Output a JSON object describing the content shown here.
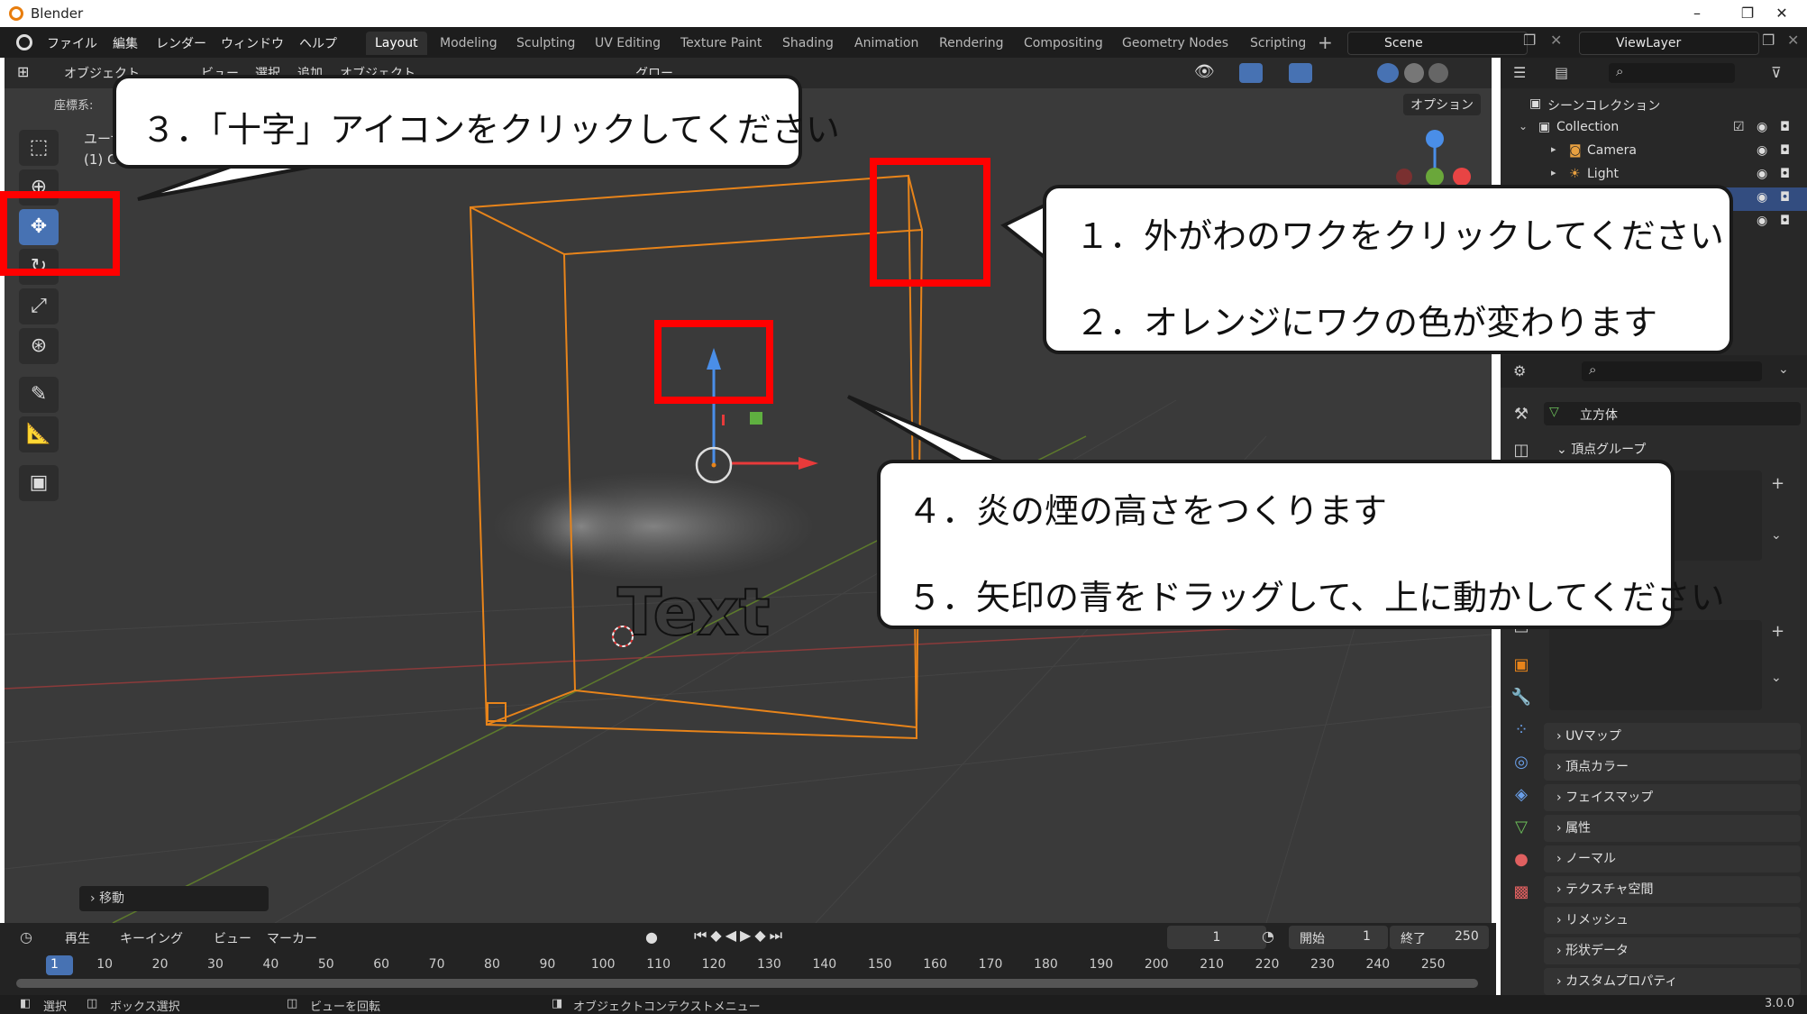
{
  "window": {
    "title": "Blender",
    "controls": [
      "–",
      "❐",
      "✕"
    ]
  },
  "menu": [
    "ファイル",
    "編集",
    "レンダー",
    "ウィンドウ",
    "ヘルプ"
  ],
  "workspaces": [
    "Layout",
    "Modeling",
    "Sculpting",
    "UV Editing",
    "Texture Paint",
    "Shading",
    "Animation",
    "Rendering",
    "Compositing",
    "Geometry Nodes",
    "Scripting"
  ],
  "active_workspace": "Layout",
  "scene": "Scene",
  "view_layer": "ViewLayer",
  "viewport": {
    "mode": "オブジェクト",
    "header_items": [
      "ビュー",
      "選択",
      "追加",
      "オブジェクト"
    ],
    "transform_label": "グロー",
    "coord_label": "座標系:",
    "options": "オプション",
    "overlay_text": [
      "ユーザ",
      "(1) Co"
    ],
    "text_object": "Text",
    "last_op": "移動"
  },
  "outliner": {
    "root": "シーンコレクション",
    "collection": "Collection",
    "items": [
      "Camera",
      "Light"
    ]
  },
  "properties": {
    "object_name": "立方体",
    "panels": [
      "頂点グループ",
      "UVマップ",
      "頂点カラー",
      "フェイスマップ",
      "属性",
      "ノーマル",
      "テクスチャ空間",
      "リメッシュ",
      "形状データ",
      "カスタムプロパティ"
    ]
  },
  "timeline": {
    "menus": [
      "再生",
      "キーイング",
      "ビュー",
      "マーカー"
    ],
    "current_frame": "1",
    "start_label": "開始",
    "start": "1",
    "end_label": "終了",
    "end": "250",
    "ruler": [
      "1",
      "10",
      "20",
      "30",
      "40",
      "50",
      "60",
      "70",
      "80",
      "90",
      "100",
      "110",
      "120",
      "130",
      "140",
      "150",
      "160",
      "170",
      "180",
      "190",
      "200",
      "210",
      "220",
      "230",
      "240",
      "250"
    ]
  },
  "statusbar": {
    "select": "選択",
    "box_select": "ボックス選択",
    "rotate": "ビューを回転",
    "context": "オブジェクトコンテクストメニュー",
    "version": "3.0.0"
  },
  "callouts": {
    "c3": "３．「十字」アイコンをクリックしてください",
    "c1": "１．外がわのワクをクリックしてください",
    "c2": "２．オレンジにワクの色が変わります",
    "c4": "４．炎の煙の高さをつくります",
    "c5": "５．矢印の青をドラッグして、上に動かしてください"
  },
  "colors": {
    "accent": "#4772b3",
    "selection": "#e8841a",
    "callout_border": "#ff0000"
  }
}
